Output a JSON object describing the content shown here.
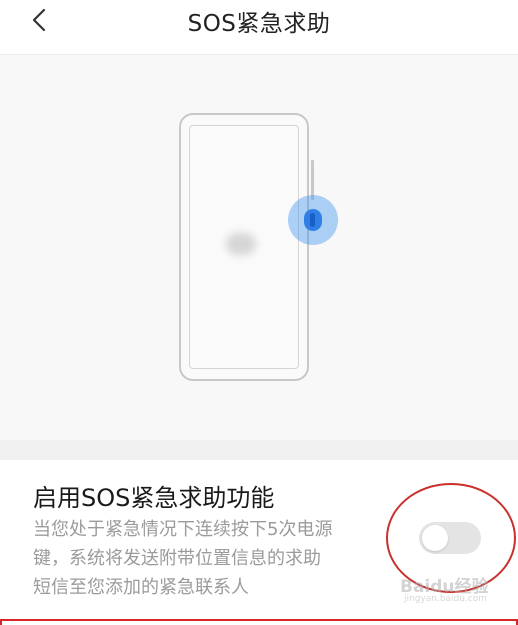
{
  "header": {
    "title": "SOS紧急求助",
    "back_icon": "chevron-left-icon"
  },
  "illustration": {
    "description_icon": "phone-side-button-press-icon",
    "accent_color": "#2f7fe6"
  },
  "setting": {
    "title": "启用SOS紧急求助功能",
    "description_lines": [
      "当您处于紧急情况下连续按下5次电源",
      "键，系统将发送附带位置信息的求助",
      "短信至您添加的紧急联系人"
    ],
    "toggle_enabled": false
  },
  "watermark": {
    "text": "Baidu经验",
    "sub": "jingyan.baidu.com"
  }
}
